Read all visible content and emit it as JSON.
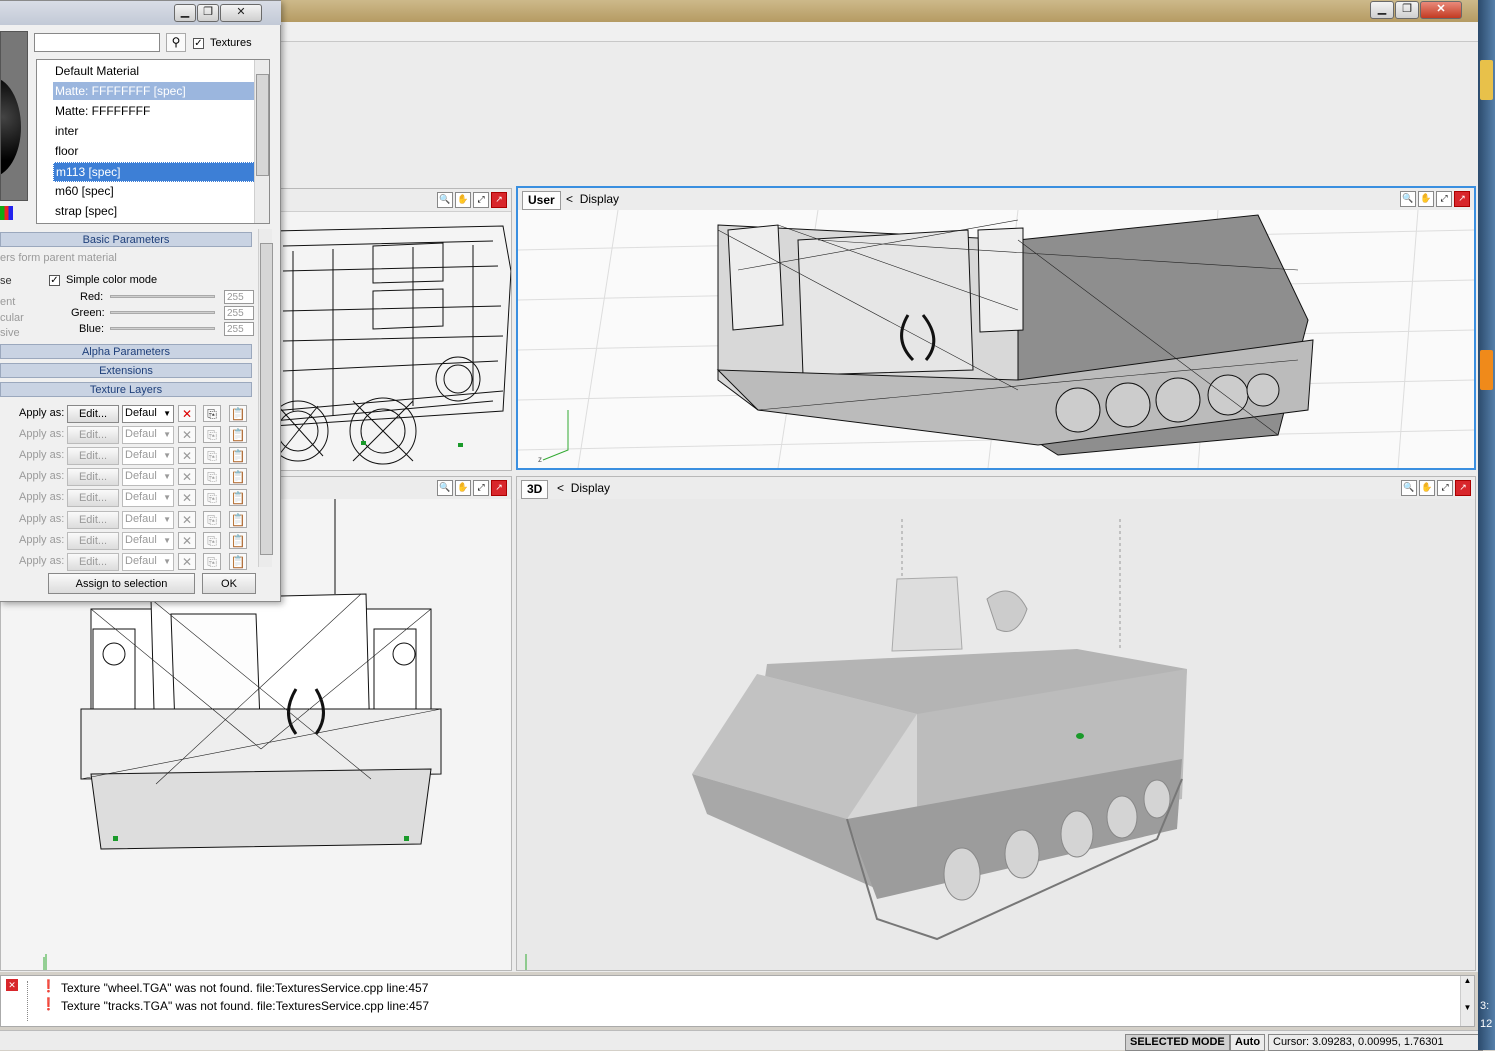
{
  "dialog": {
    "search_placeholder": "",
    "textures_label": "Textures",
    "materials": [
      "Default Material",
      "Matte: FFFFFFFF [spec]",
      "Matte: FFFFFFFF",
      "inter",
      "floor",
      "m113 [spec]",
      "m60 [spec]",
      "strap [spec]"
    ],
    "sections": {
      "basic": "Basic Parameters",
      "alpha": "Alpha Parameters",
      "extensions": "Extensions",
      "texture_layers": "Texture Layers"
    },
    "inherit_text": "ers form parent material",
    "side_labels": [
      "se",
      "ent",
      "cular",
      "sive"
    ],
    "simple_color_label": "Simple color mode",
    "red_label": "Red:",
    "green_label": "Green:",
    "blue_label": "Blue:",
    "red_value": "255",
    "green_value": "255",
    "blue_value": "255",
    "apply_as_label": "Apply as:",
    "edit_label": "Edit...",
    "combo_value": "Defaul",
    "assign_button": "Assign to selection",
    "ok_button": "OK"
  },
  "viewports": {
    "top_right": {
      "tag": "User",
      "label": "Display"
    },
    "bottom_right": {
      "tag": "3D",
      "label": "Display"
    }
  },
  "log": {
    "lines": [
      "Texture \"wheel.TGA\" was not found. file:TexturesService.cpp line:457",
      "Texture \"tracks.TGA\" was not found. file:TexturesService.cpp line:457"
    ]
  },
  "status": {
    "mode": "SELECTED MODE",
    "auto": "Auto",
    "cursor": "Cursor: 3.09283, 0.00995, 1.76301"
  },
  "taskbar": {
    "clock_top": "3:",
    "clock_bottom": "12"
  }
}
